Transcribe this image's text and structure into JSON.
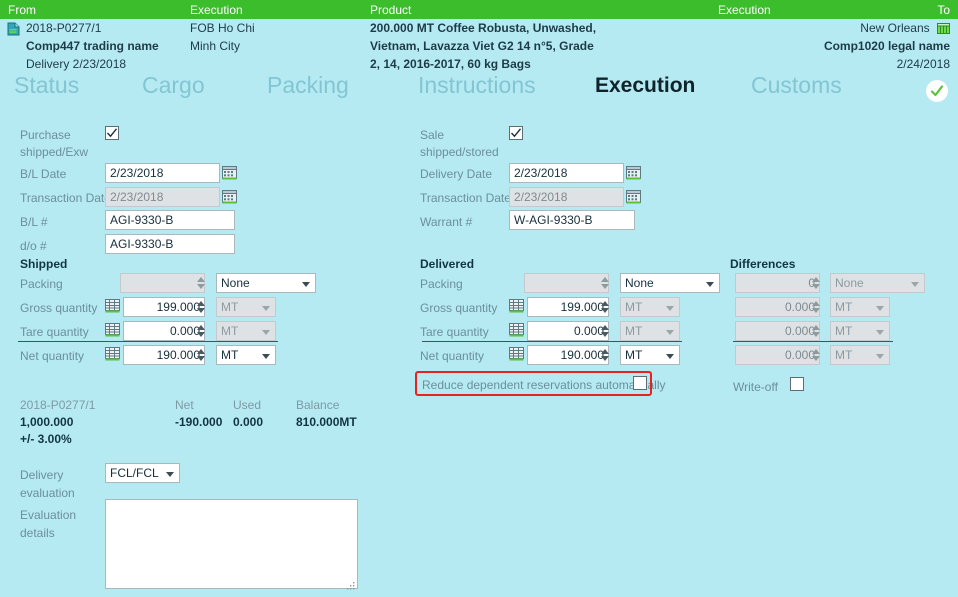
{
  "header": {
    "bar": {
      "from": "From",
      "execution_left": "Execution",
      "product": "Product",
      "execution_right": "Execution",
      "to": "To"
    },
    "from": {
      "line1": "2018-P0277/1",
      "line2": "Comp447 trading name",
      "line3": "Delivery 2/23/2018",
      "icon": "document-icon"
    },
    "execution_left": {
      "line1": "FOB Ho Chi",
      "line2": "Minh City"
    },
    "product": {
      "line1": "200.000 MT Coffee Robusta, Unwashed,",
      "line2": "Vietnam, Lavazza Viet G2 14 n°5, Grade",
      "line3": "2, 14, 2016-2017, 60 kg Bags"
    },
    "to": {
      "line1": "New Orleans",
      "line1_icon": "warehouse-icon",
      "line2": "Comp1020 legal name",
      "line3": "2/24/2018"
    }
  },
  "tabs": {
    "items": [
      {
        "label": "Status",
        "active": false
      },
      {
        "label": "Cargo",
        "active": false
      },
      {
        "label": "Packing",
        "active": false
      },
      {
        "label": "Instructions",
        "active": false
      },
      {
        "label": "Execution",
        "active": true
      },
      {
        "label": "Customs",
        "active": false
      }
    ],
    "validate_icon": "check-circle-icon"
  },
  "purchase": {
    "title": "Purchase",
    "title2": "shipped/Exw",
    "checked": true,
    "bl_date_label": "B/L Date",
    "bl_date_value": "2/23/2018",
    "transaction_date_label": "Transaction Date",
    "transaction_date_value": "2/23/2018",
    "bl_number_label": "B/L #",
    "bl_number_value": "AGI-9330-B",
    "do_number_label": "d/o #",
    "do_number_value": "AGI-9330-B"
  },
  "shipped": {
    "title": "Shipped",
    "rows": [
      {
        "label": "Packing",
        "value": "",
        "unit": "None",
        "value_disabled": true,
        "unit_disabled": false,
        "has_grid": false
      },
      {
        "label": "Gross quantity",
        "value": "199.000",
        "unit": "MT",
        "value_disabled": false,
        "unit_disabled": true,
        "has_grid": true
      },
      {
        "label": "Tare quantity",
        "value": "0.000",
        "unit": "MT",
        "value_disabled": false,
        "unit_disabled": true,
        "has_grid": true
      },
      {
        "label": "Net quantity",
        "value": "190.000",
        "unit": "MT",
        "value_disabled": false,
        "unit_disabled": false,
        "has_grid": true
      }
    ]
  },
  "sale": {
    "title": "Sale",
    "title2": "shipped/stored",
    "checked": true,
    "delivery_date_label": "Delivery Date",
    "delivery_date_value": "2/23/2018",
    "transaction_date_label": "Transaction Date",
    "transaction_date_value": "2/23/2018",
    "warrant_label": "Warrant #",
    "warrant_value": "W-AGI-9330-B"
  },
  "delivered": {
    "title": "Delivered",
    "rows": [
      {
        "label": "Packing",
        "value": "",
        "unit": "None",
        "value_disabled": true,
        "unit_disabled": false,
        "has_grid": false
      },
      {
        "label": "Gross quantity",
        "value": "199.000",
        "unit": "MT",
        "value_disabled": false,
        "unit_disabled": true,
        "has_grid": true
      },
      {
        "label": "Tare quantity",
        "value": "0.000",
        "unit": "MT",
        "value_disabled": false,
        "unit_disabled": true,
        "has_grid": true
      },
      {
        "label": "Net quantity",
        "value": "190.000",
        "unit": "MT",
        "value_disabled": false,
        "unit_disabled": false,
        "has_grid": true
      }
    ]
  },
  "differences": {
    "title": "Differences",
    "rows": [
      {
        "value": "0",
        "unit": "None"
      },
      {
        "value": "0.000",
        "unit": "MT"
      },
      {
        "value": "0.000",
        "unit": "MT"
      },
      {
        "value": "0.000",
        "unit": "MT"
      }
    ]
  },
  "options": {
    "reduce_label": "Reduce dependent reservations automatically",
    "reduce_checked": false,
    "writeoff_label": "Write-off",
    "writeoff_checked": false,
    "highlight_color": "#e8231f"
  },
  "summary": {
    "headers": [
      "2018-P0277/1",
      "Net",
      "Used",
      "Balance"
    ],
    "values": [
      "1,000.000",
      "-190.000",
      "0.000",
      "810.000MT"
    ],
    "tolerance": "+/- 3.00%"
  },
  "evaluation": {
    "delivery_label1": "Delivery",
    "delivery_label2": "evaluation",
    "delivery_value": "FCL/FCL",
    "details_label1": "Evaluation",
    "details_label2": "details",
    "details_value": ""
  }
}
